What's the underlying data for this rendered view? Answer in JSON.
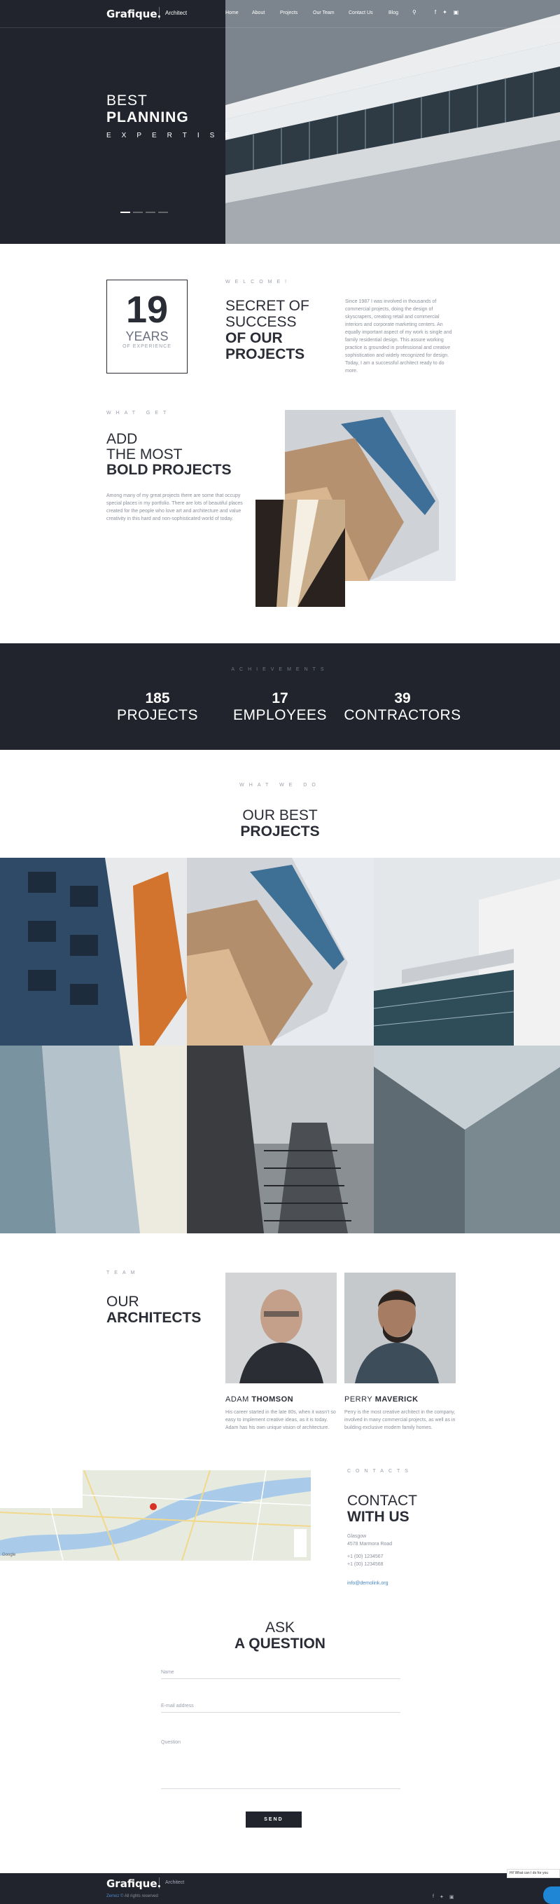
{
  "header": {
    "logo": "Grafique.",
    "logo_sub": "Architect",
    "nav": [
      "Home",
      "About",
      "Projects",
      "Our Team",
      "Contact Us",
      "Blog"
    ],
    "icons": [
      "search-icon",
      "facebook-icon",
      "twitter-icon",
      "instagram-icon"
    ]
  },
  "hero": {
    "line1": "BEST",
    "line2": "PLANNING",
    "line3": "EXPERTISE"
  },
  "welcome": {
    "label": "WELCOME!",
    "years_num": "19",
    "years_word": "YEARS",
    "years_sub": "OF EXPERIENCE",
    "title_light1": "SECRET OF",
    "title_light2": "SUCCESS",
    "title_bold1": "OF OUR",
    "title_bold2": "PROJECTS",
    "text": "Since 1987 I was involved in thousands of commercial projects, doing the design of skyscrapers, creating retail and commercial interiors and corporate marketing centers. An equally important aspect of my work is single and family residential design. This assure working practice is grounded in professional and creative sophistication and widely recognized for design. Today, I am a successful architect ready to do more."
  },
  "whatget": {
    "label": "WHAT GET",
    "title_light1": "ADD",
    "title_light2": "THE MOST",
    "title_bold": "BOLD PROJECTS",
    "text": "Among many of my great projects there are some that occupy special places in my portfolio. There are lots of beautiful places created for the people who love art and architecture and value creativity in this hard and non-sophisticated world of today."
  },
  "achievements": {
    "label": "ACHIEVEMENTS",
    "stats": [
      {
        "num": "185",
        "word": "PROJECTS"
      },
      {
        "num": "17",
        "word": "EMPLOYEES"
      },
      {
        "num": "39",
        "word": "CONTRACTORS"
      }
    ]
  },
  "projects": {
    "label": "WHAT WE DO",
    "title_light": "OUR BEST",
    "title_bold": "PROJECTS"
  },
  "team": {
    "label": "TEAM",
    "title_light": "OUR",
    "title_bold": "ARCHITECTS",
    "members": [
      {
        "first": "ADAM",
        "last": "THOMSON",
        "text": "His career started in the late 80s, when it wasn't so easy to implement creative ideas, as it is today. Adam has his own unique vision of architecture."
      },
      {
        "first": "PERRY",
        "last": "MAVERICK",
        "text": "Perry is the most creative architect in the company, involved in many commercial projects, as well as in building exclusive modern family homes."
      }
    ]
  },
  "contact": {
    "label": "CONTACTS",
    "title_light": "CONTACT",
    "title_bold": "WITH US",
    "address1": "Glasgow",
    "address2": "4578 Marmora Road",
    "phone1": "+1 (00) 1234567",
    "phone2": "+1 (00) 1234568",
    "email": "info@demolink.org",
    "map_label": "Google"
  },
  "ask": {
    "title_light": "ASK",
    "title_bold": "A QUESTION",
    "name_placeholder": "Name",
    "email_placeholder": "E-mail address",
    "question_placeholder": "Question",
    "send": "SEND"
  },
  "footer": {
    "logo": "Grafique.",
    "logo_sub": "Architect",
    "copy_brand": "Zemez ©",
    "copy_text": "All rights reserved"
  },
  "chat": {
    "tooltip": "Hi! What can I do for you"
  }
}
